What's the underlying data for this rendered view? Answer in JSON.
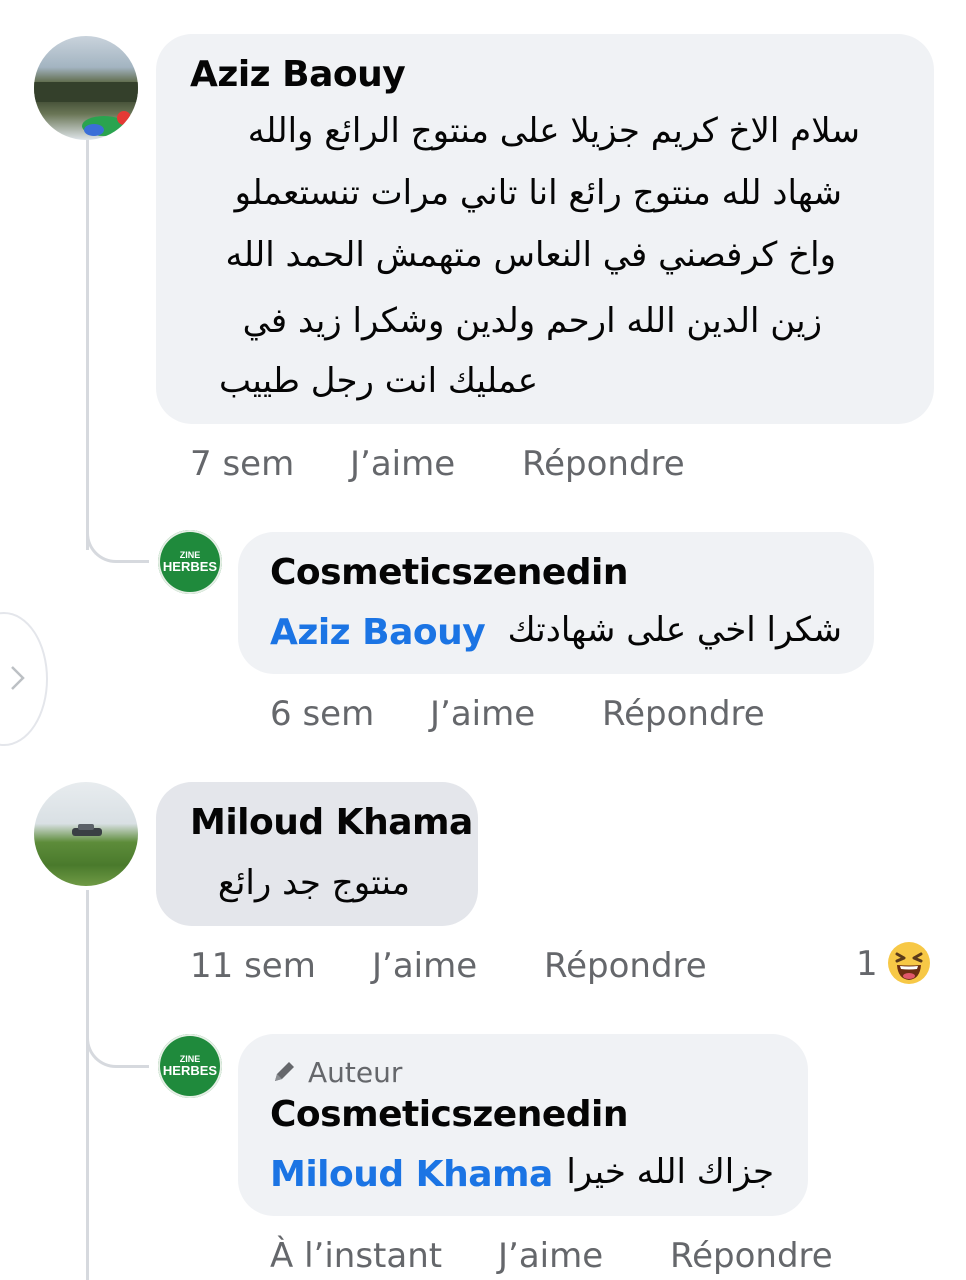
{
  "comments": [
    {
      "author": "Aziz Baouy",
      "text_lines": [
        "سلام الاخ كريم جزيلا على منتوج الرائع والله",
        "شهاد لله منتوج رائع انا تاني مرات تنستعملو",
        "واخ كرفصني في النعاس متهمش الحمد الله",
        "زين الدين الله ارحم ولدين  وشكرا زيد في",
        "عمليك انت رجل طييب"
      ],
      "time": "7 sem",
      "like_label": "J’aime",
      "reply_label": "Répondre",
      "reply": {
        "author": "Cosmeticszenedin",
        "avatar_text_top": "ZINE",
        "avatar_text_bottom": "HERBES",
        "mention": "Aziz Baouy",
        "text": "شكرا اخي على شهادتك",
        "time": "6 sem",
        "like_label": "J’aime",
        "reply_label": "Répondre"
      }
    },
    {
      "author": "Miloud Khama",
      "text_lines": [
        "منتوج جد رائع"
      ],
      "time": "11 sem",
      "like_label": "J’aime",
      "reply_label": "Répondre",
      "reaction_count": "1",
      "reaction_icon": "laughing-emoji-icon",
      "reply": {
        "author_badge": "Auteur",
        "author": "Cosmeticszenedin",
        "avatar_text_top": "ZINE",
        "avatar_text_bottom": "HERBES",
        "mention": "Miloud Khama",
        "text": "جزاك الله خيرا",
        "time": "À l’instant",
        "like_label": "J’aime",
        "reply_label": "Répondre"
      }
    }
  ],
  "colors": {
    "bubble": "#f0f2f5",
    "bubble_selected": "#e4e6eb",
    "mention": "#1b74e4",
    "meta": "#65676b",
    "brand_green": "#1f8a3c"
  }
}
